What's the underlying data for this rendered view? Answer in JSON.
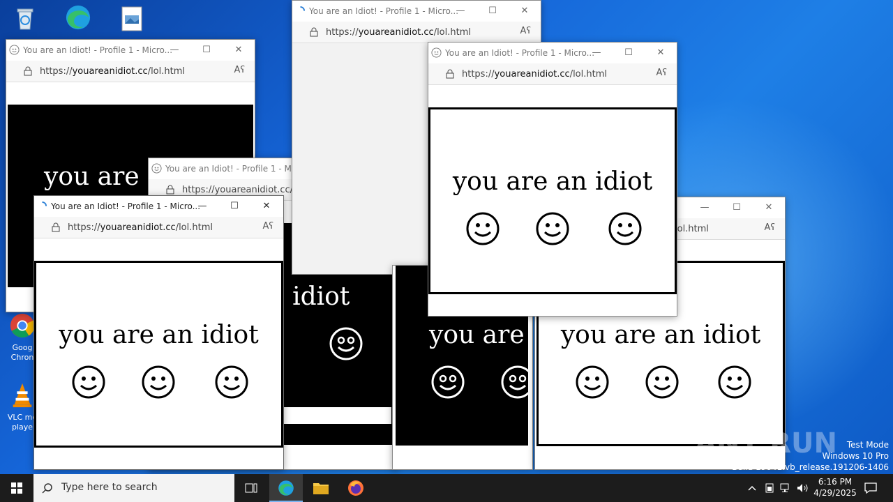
{
  "desktop": {
    "icons": [
      {
        "name": "Recycle Bin",
        "label": ""
      },
      {
        "name": "Microsoft Edge",
        "label": ""
      },
      {
        "name": "Image file",
        "label": ""
      },
      {
        "name": "Google Chrome",
        "label": "Goog Chron"
      },
      {
        "name": "VLC media player",
        "label": "VLC me playe"
      }
    ]
  },
  "windows": {
    "title": "You are an Idiot! - Profile 1 - Micro...",
    "url_prefix": "https://",
    "url_domain": "youareanidiot.cc",
    "url_path": "/lol.html",
    "url_fragment_partial": "lol.html",
    "url_cut": "https://youareanidiot.cc/lo",
    "title_cut": "You are an Idiot! - Profile 1 - Micro",
    "message": "you are an idiot",
    "message_partial_a": "you are a",
    "message_partial_b": "an idiot",
    "message_partial_c": "you are",
    "minimize": "—",
    "maximize": "☐",
    "close": "✕",
    "read_aloud": "Aʕ"
  },
  "taskbar": {
    "search_placeholder": "Type here to search",
    "time": "6:16 PM",
    "date": "4/29/2025"
  },
  "watermark": {
    "mode": "Test Mode",
    "edition": "Windows 10 Pro",
    "build": "Build 19041.vb_release.191206-1406",
    "brand": "ANY RUN"
  },
  "colors": {
    "desktop_blue": "#1565d8",
    "taskbar": "#1c1c1c",
    "panel_black": "#000000",
    "panel_white": "#ffffff"
  }
}
